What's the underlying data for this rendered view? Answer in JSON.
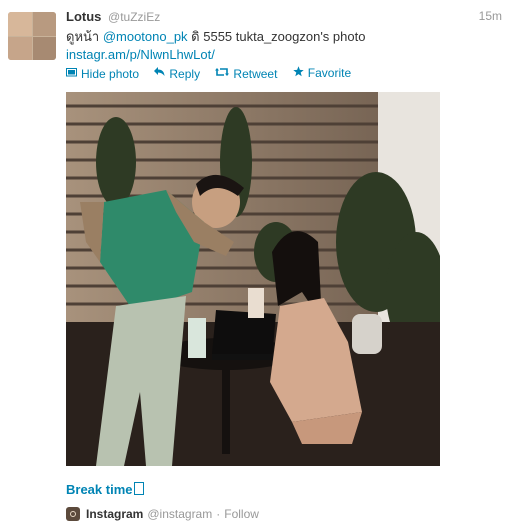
{
  "tweet": {
    "name": "Lotus",
    "handle": "@tuZziEz",
    "time": "15m",
    "text_pre": "ดูหน้า ",
    "mention": "@mootono_pk",
    "text_post": " ดิ 5555 tukta_zoogzon's photo",
    "url": "instagr.am/p/NlwnLhwLot/"
  },
  "actions": {
    "hide_photo": "Hide photo",
    "reply": "Reply",
    "retweet": "Retweet",
    "favorite": "Favorite"
  },
  "media": {
    "caption": "Break time",
    "source_name": "Instagram",
    "source_handle": "@instagram",
    "separator": "·",
    "follow": "Follow"
  },
  "icons": {
    "hide_photo": "photo-icon",
    "reply": "reply-arrow-icon",
    "retweet": "retweet-icon",
    "favorite": "star-icon",
    "source": "instagram-icon"
  },
  "colors": {
    "link": "#0084b4",
    "muted": "#999999",
    "text": "#333333"
  }
}
